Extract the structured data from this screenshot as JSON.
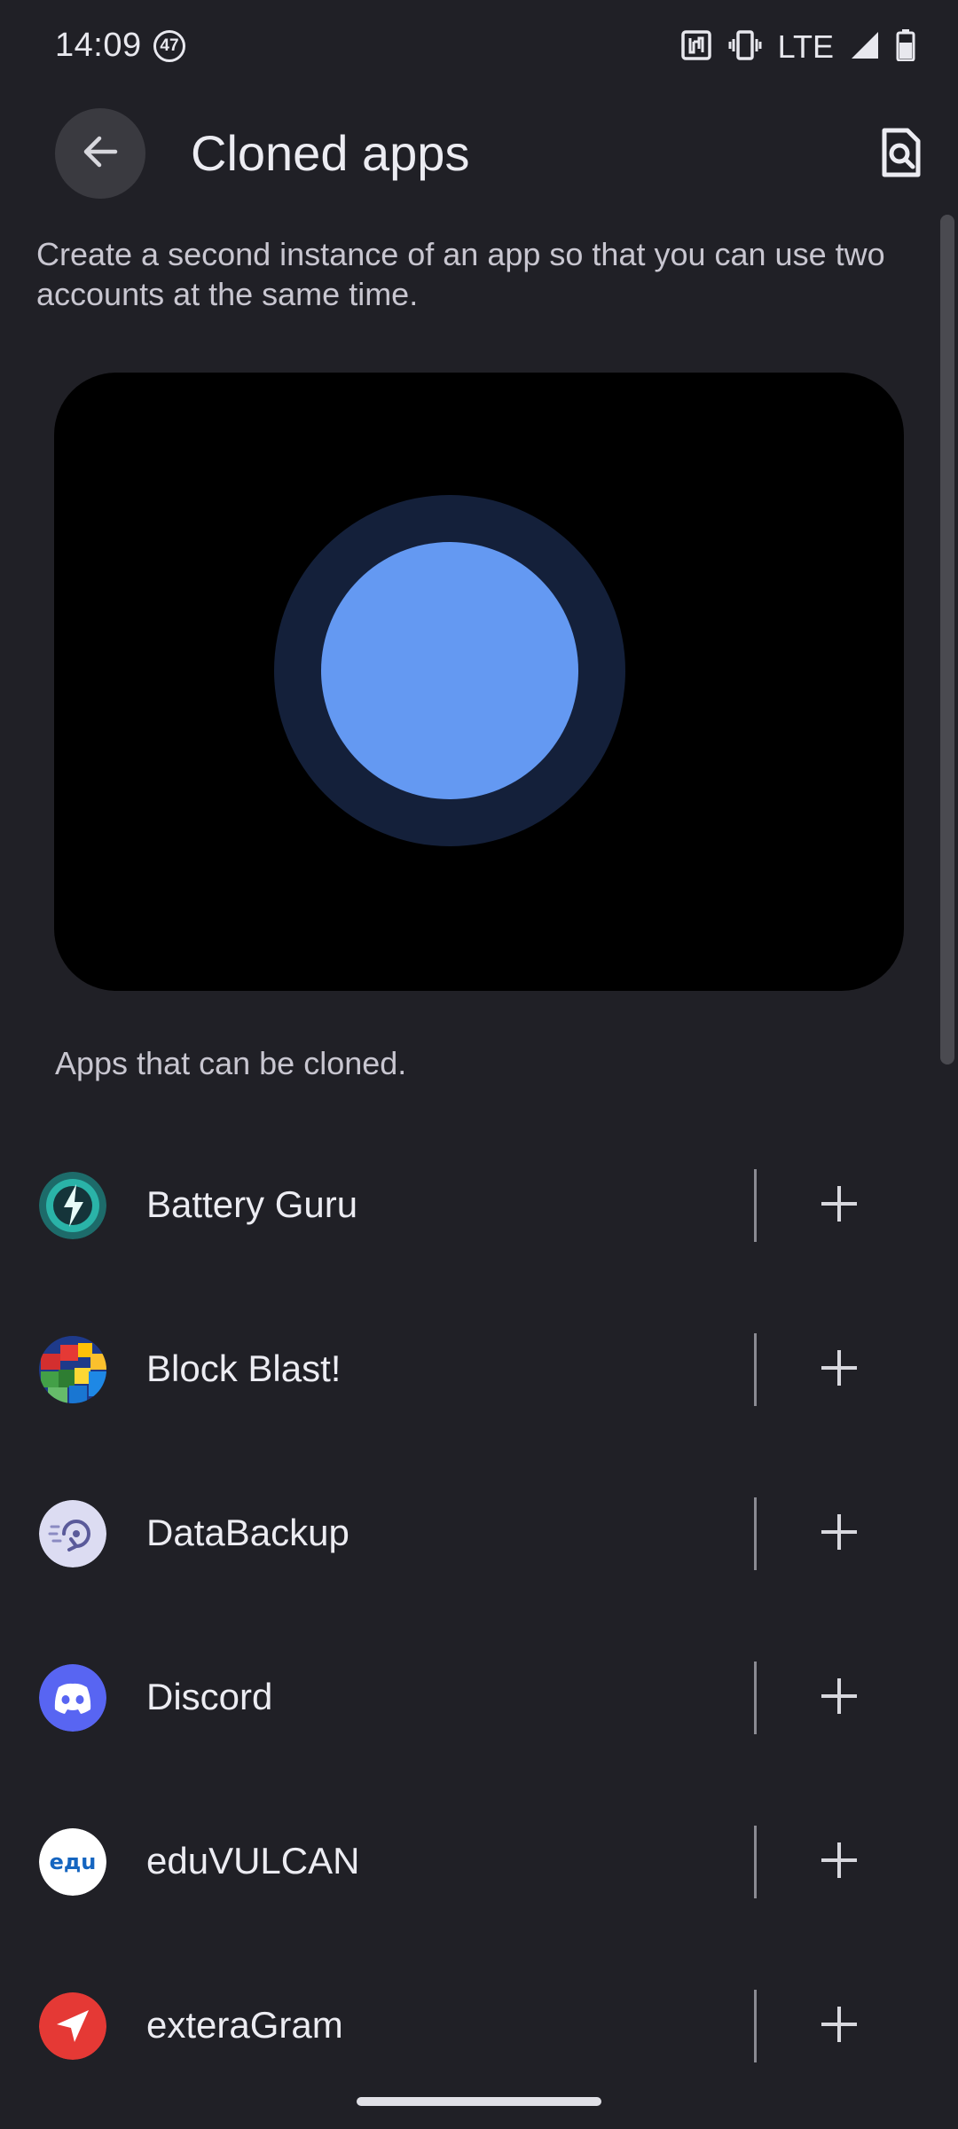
{
  "status_bar": {
    "time": "14:09",
    "notification_count": "47",
    "network": "LTE",
    "icons": [
      "nfc-icon",
      "vibrate-icon",
      "signal-icon",
      "battery-icon"
    ]
  },
  "header": {
    "title": "Cloned apps",
    "back_icon": "arrow-back-icon",
    "search_icon": "search-page-icon"
  },
  "description": "Create a second instance of an app so that you can use two accounts at the same time.",
  "section_label": "Apps that can be cloned.",
  "apps": [
    {
      "name": "Battery Guru",
      "icon": "battery-guru-icon"
    },
    {
      "name": "Block Blast!",
      "icon": "block-blast-icon"
    },
    {
      "name": "DataBackup",
      "icon": "databackup-icon"
    },
    {
      "name": "Discord",
      "icon": "discord-icon"
    },
    {
      "name": "eduVULCAN",
      "icon": "eduvulcan-icon",
      "icon_text": "eдu"
    },
    {
      "name": "exteraGram",
      "icon": "exteragram-icon"
    }
  ],
  "colors": {
    "background": "#202026",
    "illustration_ring": "#14203a",
    "illustration_core": "#6499f2",
    "back_button": "#3a3a40"
  }
}
